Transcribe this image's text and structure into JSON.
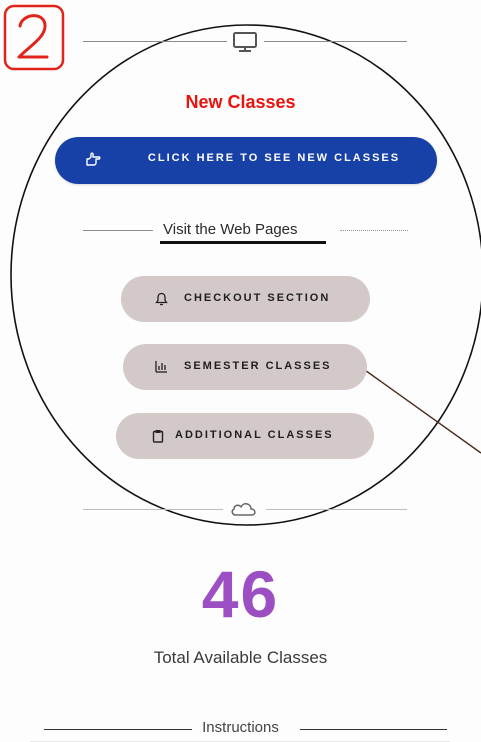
{
  "annotation": {
    "step_number": "2"
  },
  "header": {
    "monitor_icon": "monitor-icon"
  },
  "new_classes": {
    "heading": "New Classes",
    "button_label": "CLICK HERE TO SEE NEW CLASSES",
    "button_icon": "pointing-hand-icon",
    "button_color": "#1741a6",
    "heading_color": "#e8140f"
  },
  "visit": {
    "label": "Visit the Web Pages"
  },
  "links": [
    {
      "label": "CHECKOUT SECTION",
      "icon": "bell-icon"
    },
    {
      "label": "SEMESTER CLASSES",
      "icon": "bar-chart-icon"
    },
    {
      "label": "ADDITIONAL CLASSES",
      "icon": "clipboard-icon"
    }
  ],
  "divider": {
    "icon": "cloud-icon"
  },
  "stats": {
    "count": "46",
    "label": "Total Available Classes",
    "count_color": "#9b4fc2"
  },
  "instructions": {
    "label": "Instructions"
  }
}
